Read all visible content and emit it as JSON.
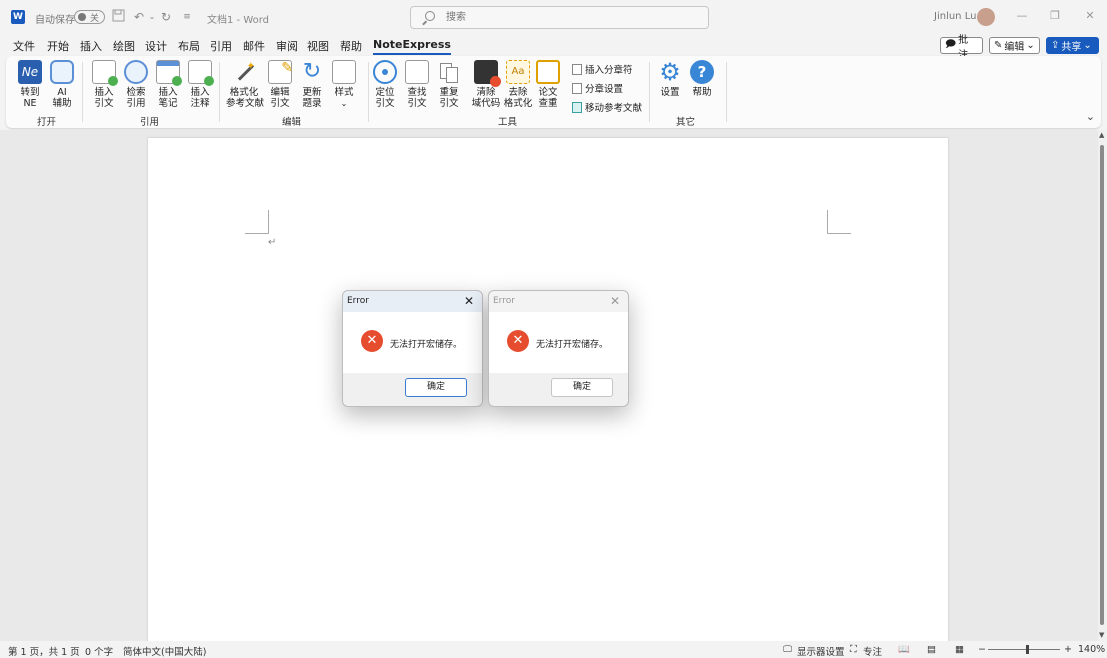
{
  "titlebar": {
    "autosave_label": "自动保存",
    "autosave_state": "关",
    "doc_title": "文档1  -  Word",
    "search_placeholder": "搜索",
    "user_name": "Jinlun Lu"
  },
  "tabs": [
    "文件",
    "开始",
    "插入",
    "绘图",
    "设计",
    "布局",
    "引用",
    "邮件",
    "审阅",
    "视图",
    "帮助",
    "NoteExpress"
  ],
  "actions": {
    "comment": "批注",
    "edit": "编辑",
    "share": "共享"
  },
  "ribbon": {
    "open": {
      "label": "打开",
      "items": [
        "转到\nNE",
        "AI\n辅助"
      ]
    },
    "cite": {
      "label": "引用",
      "items": [
        "插入\n引文",
        "检索\n引用",
        "插入\n笔记",
        "插入\n注释"
      ]
    },
    "edit": {
      "label": "编辑",
      "items": [
        "格式化\n参考文献",
        "编辑\n引文",
        "更新\n题录",
        "样式"
      ]
    },
    "tools": {
      "label": "工具",
      "items": [
        "定位\n引文",
        "查找\n引文",
        "重复\n引文",
        "清除\n域代码",
        "去除\n格式化",
        "论文\n查重"
      ],
      "small_items": [
        "插入分章符",
        "分章设置",
        "移动参考文献"
      ]
    },
    "other": {
      "label": "其它",
      "items": [
        "设置",
        "帮助"
      ]
    }
  },
  "dialogs": [
    {
      "title": "Error",
      "message": "无法打开宏储存。",
      "ok": "确定"
    },
    {
      "title": "Error",
      "message": "无法打开宏储存。",
      "ok": "确定"
    }
  ],
  "statusbar": {
    "page": "第 1 页，共 1 页",
    "words": "0 个字",
    "language": "简体中文(中国大陆)",
    "display": "显示器设置",
    "focus": "专注",
    "zoom": "140%"
  },
  "colors": {
    "accent": "#185abd",
    "error": "#e54d2e"
  }
}
